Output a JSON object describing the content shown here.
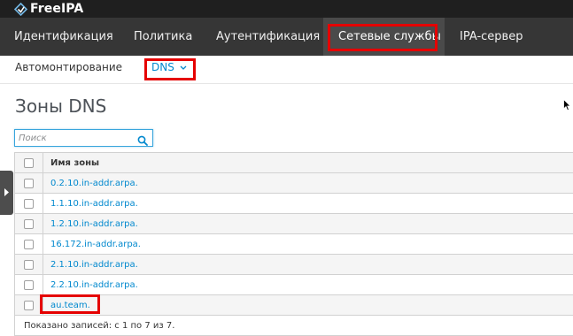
{
  "brand": {
    "name": "FreeIPA",
    "icon": "freeipa-logo"
  },
  "main_nav": {
    "items": [
      {
        "label": "Идентификация"
      },
      {
        "label": "Политика"
      },
      {
        "label": "Аутентификация"
      },
      {
        "label": "Сетевые службы",
        "active": true
      },
      {
        "label": "IPA-сервер"
      }
    ]
  },
  "sub_nav": {
    "items": [
      {
        "label": "Автомонтирование"
      },
      {
        "label": "DNS",
        "active": true,
        "icon": "chevron-down-icon"
      }
    ]
  },
  "page": {
    "title": "Зоны DNS"
  },
  "search": {
    "placeholder": "Поиск",
    "value": "",
    "icon": "search-icon"
  },
  "table": {
    "column_header": "Имя зоны",
    "rows": [
      "0.2.10.in-addr.arpa.",
      "1.1.10.in-addr.arpa.",
      "1.2.10.in-addr.arpa.",
      "16.172.in-addr.arpa.",
      "2.1.10.in-addr.arpa.",
      "2.2.10.in-addr.arpa.",
      "au.team."
    ],
    "footer": "Показано записей: с 1 по 7 из 7."
  },
  "colors": {
    "brand_bar": "#1f1f1f",
    "main_nav_bg": "#363636",
    "link": "#0088ce",
    "highlight": "#e50000",
    "logo_accent": "#72b6e4"
  }
}
